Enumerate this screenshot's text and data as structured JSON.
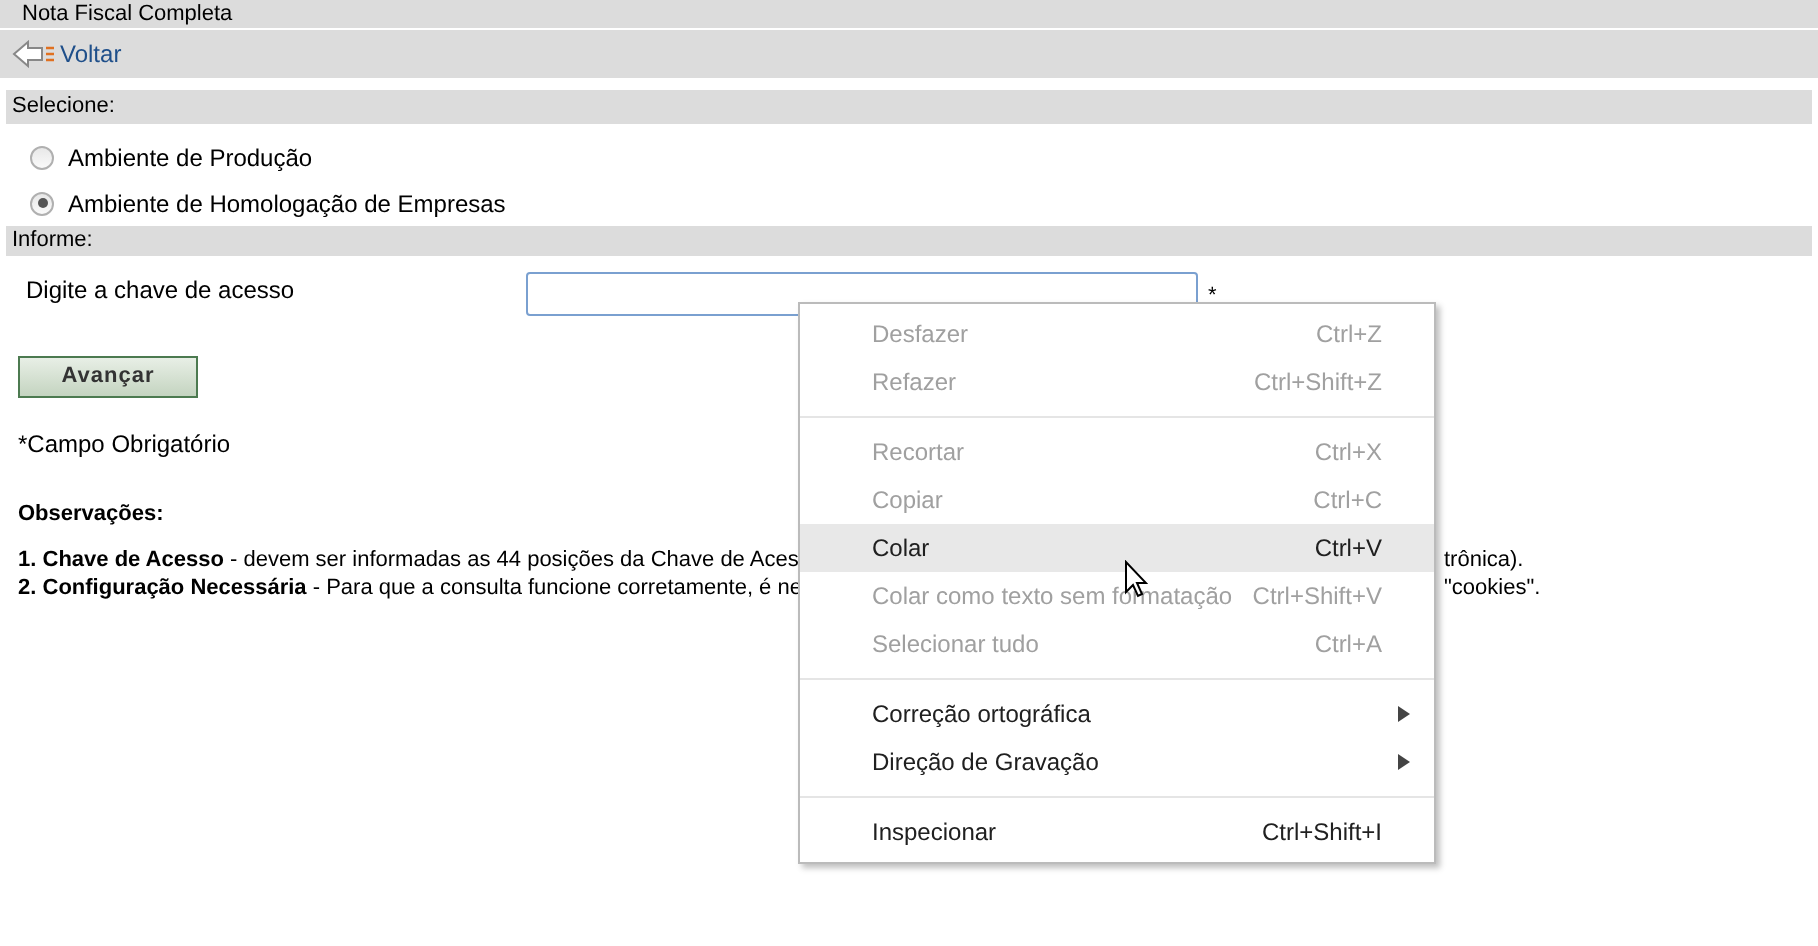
{
  "title": "Nota Fiscal Completa",
  "back_link": "Voltar",
  "select_section": {
    "heading": "Selecione:",
    "options": [
      {
        "label": "Ambiente de Produção",
        "selected": false
      },
      {
        "label": "Ambiente de Homologação de Empresas",
        "selected": true
      }
    ]
  },
  "inform_section": {
    "heading": "Informe:",
    "field_label": "Digite a chave de acesso",
    "required_mark": "*"
  },
  "submit_button": "Avançar",
  "required_note": "*Campo Obrigatório",
  "notes": {
    "heading": "Observações:",
    "items": [
      {
        "number": "1.",
        "title": "Chave de Acesso",
        "text": " - devem ser informadas as 44 posições da Chave de Aces",
        "tail": "trônica)."
      },
      {
        "number": "2.",
        "title": "Configuração Necessária",
        "text": " - Para que a consulta funcione corretamente, é ne",
        "tail": "\"cookies\"."
      }
    ]
  },
  "context_menu": {
    "items": [
      {
        "kind": "item",
        "label": "Desfazer",
        "shortcut": "Ctrl+Z",
        "disabled": true,
        "selected": false
      },
      {
        "kind": "item",
        "label": "Refazer",
        "shortcut": "Ctrl+Shift+Z",
        "disabled": true,
        "selected": false
      },
      {
        "kind": "separator"
      },
      {
        "kind": "item",
        "label": "Recortar",
        "shortcut": "Ctrl+X",
        "disabled": true,
        "selected": false
      },
      {
        "kind": "item",
        "label": "Copiar",
        "shortcut": "Ctrl+C",
        "disabled": true,
        "selected": false
      },
      {
        "kind": "item",
        "label": "Colar",
        "shortcut": "Ctrl+V",
        "disabled": false,
        "selected": true
      },
      {
        "kind": "item",
        "label": "Colar como texto sem formatação",
        "shortcut": "Ctrl+Shift+V",
        "disabled": true,
        "selected": false
      },
      {
        "kind": "item",
        "label": "Selecionar tudo",
        "shortcut": "Ctrl+A",
        "disabled": true,
        "selected": false
      },
      {
        "kind": "separator"
      },
      {
        "kind": "submenu",
        "label": "Correção ortográfica",
        "disabled": false,
        "selected": false
      },
      {
        "kind": "submenu",
        "label": "Direção de Gravação",
        "disabled": false,
        "selected": false
      },
      {
        "kind": "separator"
      },
      {
        "kind": "item",
        "label": "Inspecionar",
        "shortcut": "Ctrl+Shift+I",
        "disabled": false,
        "selected": false
      }
    ]
  }
}
